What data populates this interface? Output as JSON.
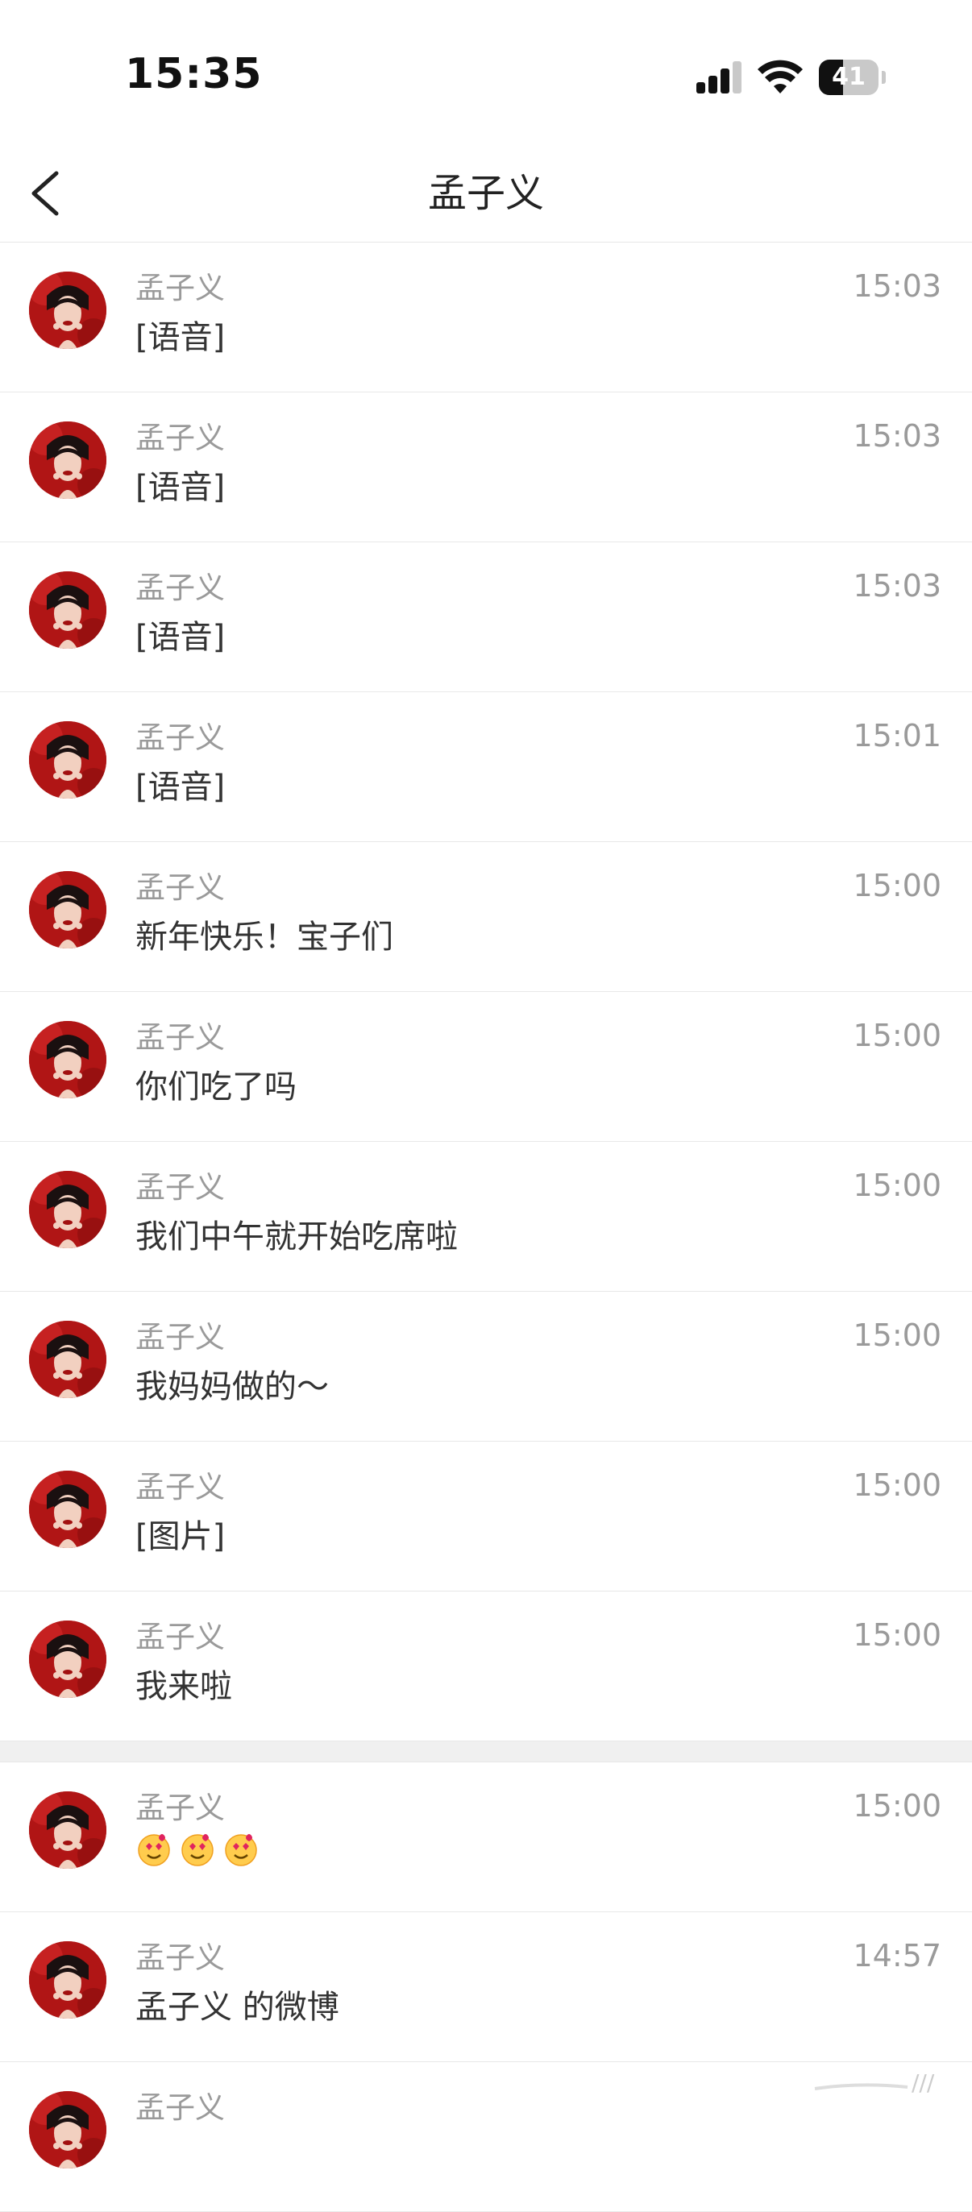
{
  "status_bar": {
    "time": "15:35",
    "battery_level": "41",
    "battery_fraction": 0.41,
    "signal_bars": 3,
    "icons": [
      "signal-icon",
      "wifi-icon",
      "battery-icon"
    ]
  },
  "nav": {
    "title": "孟子义",
    "back_icon": "chevron-left-icon"
  },
  "messages": [
    {
      "sender": "孟子义",
      "text": "[语音]",
      "time": "15:03"
    },
    {
      "sender": "孟子义",
      "text": "[语音]",
      "time": "15:03"
    },
    {
      "sender": "孟子义",
      "text": "[语音]",
      "time": "15:03"
    },
    {
      "sender": "孟子义",
      "text": "[语音]",
      "time": "15:01"
    },
    {
      "sender": "孟子义",
      "text": "新年快乐！宝子们",
      "time": "15:00"
    },
    {
      "sender": "孟子义",
      "text": "你们吃了吗",
      "time": "15:00"
    },
    {
      "sender": "孟子义",
      "text": "我们中午就开始吃席啦",
      "time": "15:00"
    },
    {
      "sender": "孟子义",
      "text": "我妈妈做的～",
      "time": "15:00"
    },
    {
      "sender": "孟子义",
      "text": "[图片]",
      "time": "15:00"
    },
    {
      "sender": "孟子义",
      "text": "我来啦",
      "time": "15:00"
    },
    {
      "sender": "孟子义",
      "text": "",
      "time": "15:00",
      "emoji_count": 3,
      "emoji_icon": "heart-eyes-emoji-icon"
    },
    {
      "sender": "孟子义",
      "text": "孟子义 的微博",
      "time": "14:57"
    },
    {
      "sender": "孟子义",
      "text": "",
      "time": ""
    }
  ],
  "colors": {
    "accent_avatar_bg": "#b01515",
    "secondary_text": "#9a9a9a",
    "divider": "#e8e8e8"
  }
}
